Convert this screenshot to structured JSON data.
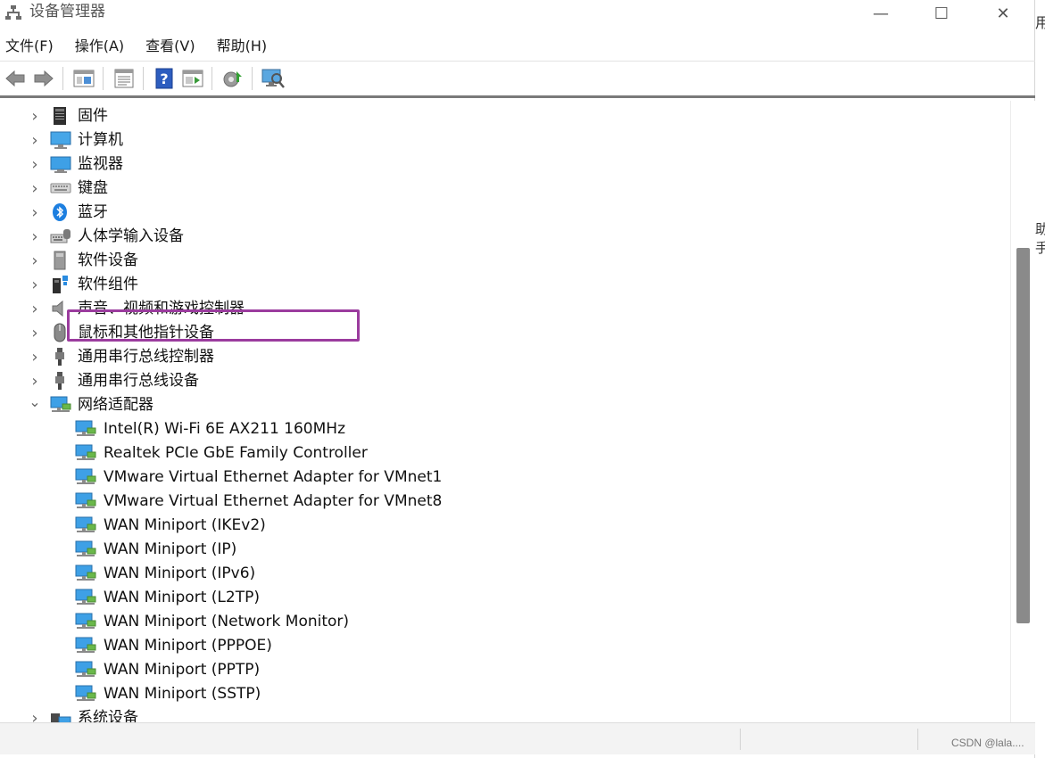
{
  "window": {
    "title": "设备管理器",
    "controls": {
      "minimize": "—",
      "maximize": "☐",
      "close": "✕"
    }
  },
  "menu": [
    {
      "label": "文件(F)"
    },
    {
      "label": "操作(A)"
    },
    {
      "label": "查看(V)"
    },
    {
      "label": "帮助(H)"
    }
  ],
  "toolbar": [
    {
      "icon": "back-arrow-icon"
    },
    {
      "icon": "forward-arrow-icon"
    },
    {
      "icon": "show-hide-console-tree-icon"
    },
    {
      "icon": "properties-icon"
    },
    {
      "icon": "help-icon"
    },
    {
      "icon": "show-action-pane-icon"
    },
    {
      "icon": "update-driver-icon"
    },
    {
      "icon": "scan-hardware-changes-icon"
    }
  ],
  "tree": {
    "categories": [
      {
        "label": "固件",
        "icon": "firmware-icon",
        "expanded": false
      },
      {
        "label": "计算机",
        "icon": "computer-icon",
        "expanded": false
      },
      {
        "label": "监视器",
        "icon": "monitor-icon",
        "expanded": false
      },
      {
        "label": "键盘",
        "icon": "keyboard-icon",
        "expanded": false
      },
      {
        "label": "蓝牙",
        "icon": "bluetooth-icon",
        "expanded": false
      },
      {
        "label": "人体学输入设备",
        "icon": "hid-icon",
        "expanded": false
      },
      {
        "label": "软件设备",
        "icon": "software-device-icon",
        "expanded": false
      },
      {
        "label": "软件组件",
        "icon": "software-component-icon",
        "expanded": false
      },
      {
        "label": "声音、视频和游戏控制器",
        "icon": "speaker-icon",
        "expanded": false
      },
      {
        "label": "鼠标和其他指针设备",
        "icon": "mouse-icon",
        "expanded": false
      },
      {
        "label": "通用串行总线控制器",
        "icon": "usb-icon",
        "expanded": false
      },
      {
        "label": "通用串行总线设备",
        "icon": "usb-icon",
        "expanded": false
      },
      {
        "label": "网络适配器",
        "icon": "network-adapter-icon",
        "expanded": true
      }
    ],
    "network_adapters": [
      {
        "label": "Intel(R) Wi-Fi 6E AX211 160MHz",
        "highlighted": true
      },
      {
        "label": "Realtek PCIe GbE Family Controller"
      },
      {
        "label": "VMware Virtual Ethernet Adapter for VMnet1"
      },
      {
        "label": "VMware Virtual Ethernet Adapter for VMnet8"
      },
      {
        "label": "WAN Miniport (IKEv2)"
      },
      {
        "label": "WAN Miniport (IP)"
      },
      {
        "label": "WAN Miniport (IPv6)"
      },
      {
        "label": "WAN Miniport (L2TP)"
      },
      {
        "label": "WAN Miniport (Network Monitor)"
      },
      {
        "label": "WAN Miniport (PPPOE)"
      },
      {
        "label": "WAN Miniport (PPTP)"
      },
      {
        "label": "WAN Miniport (SSTP)"
      }
    ],
    "after": [
      {
        "label": "系统设备",
        "icon": "system-device-icon",
        "expanded": false
      }
    ]
  },
  "status": {
    "watermark": "CSDN @lala...."
  },
  "edge_fragments": [
    "用",
    "助手"
  ],
  "colors": {
    "highlight": "#9b3c9e",
    "scroll_thumb": "#8a8a8a"
  }
}
